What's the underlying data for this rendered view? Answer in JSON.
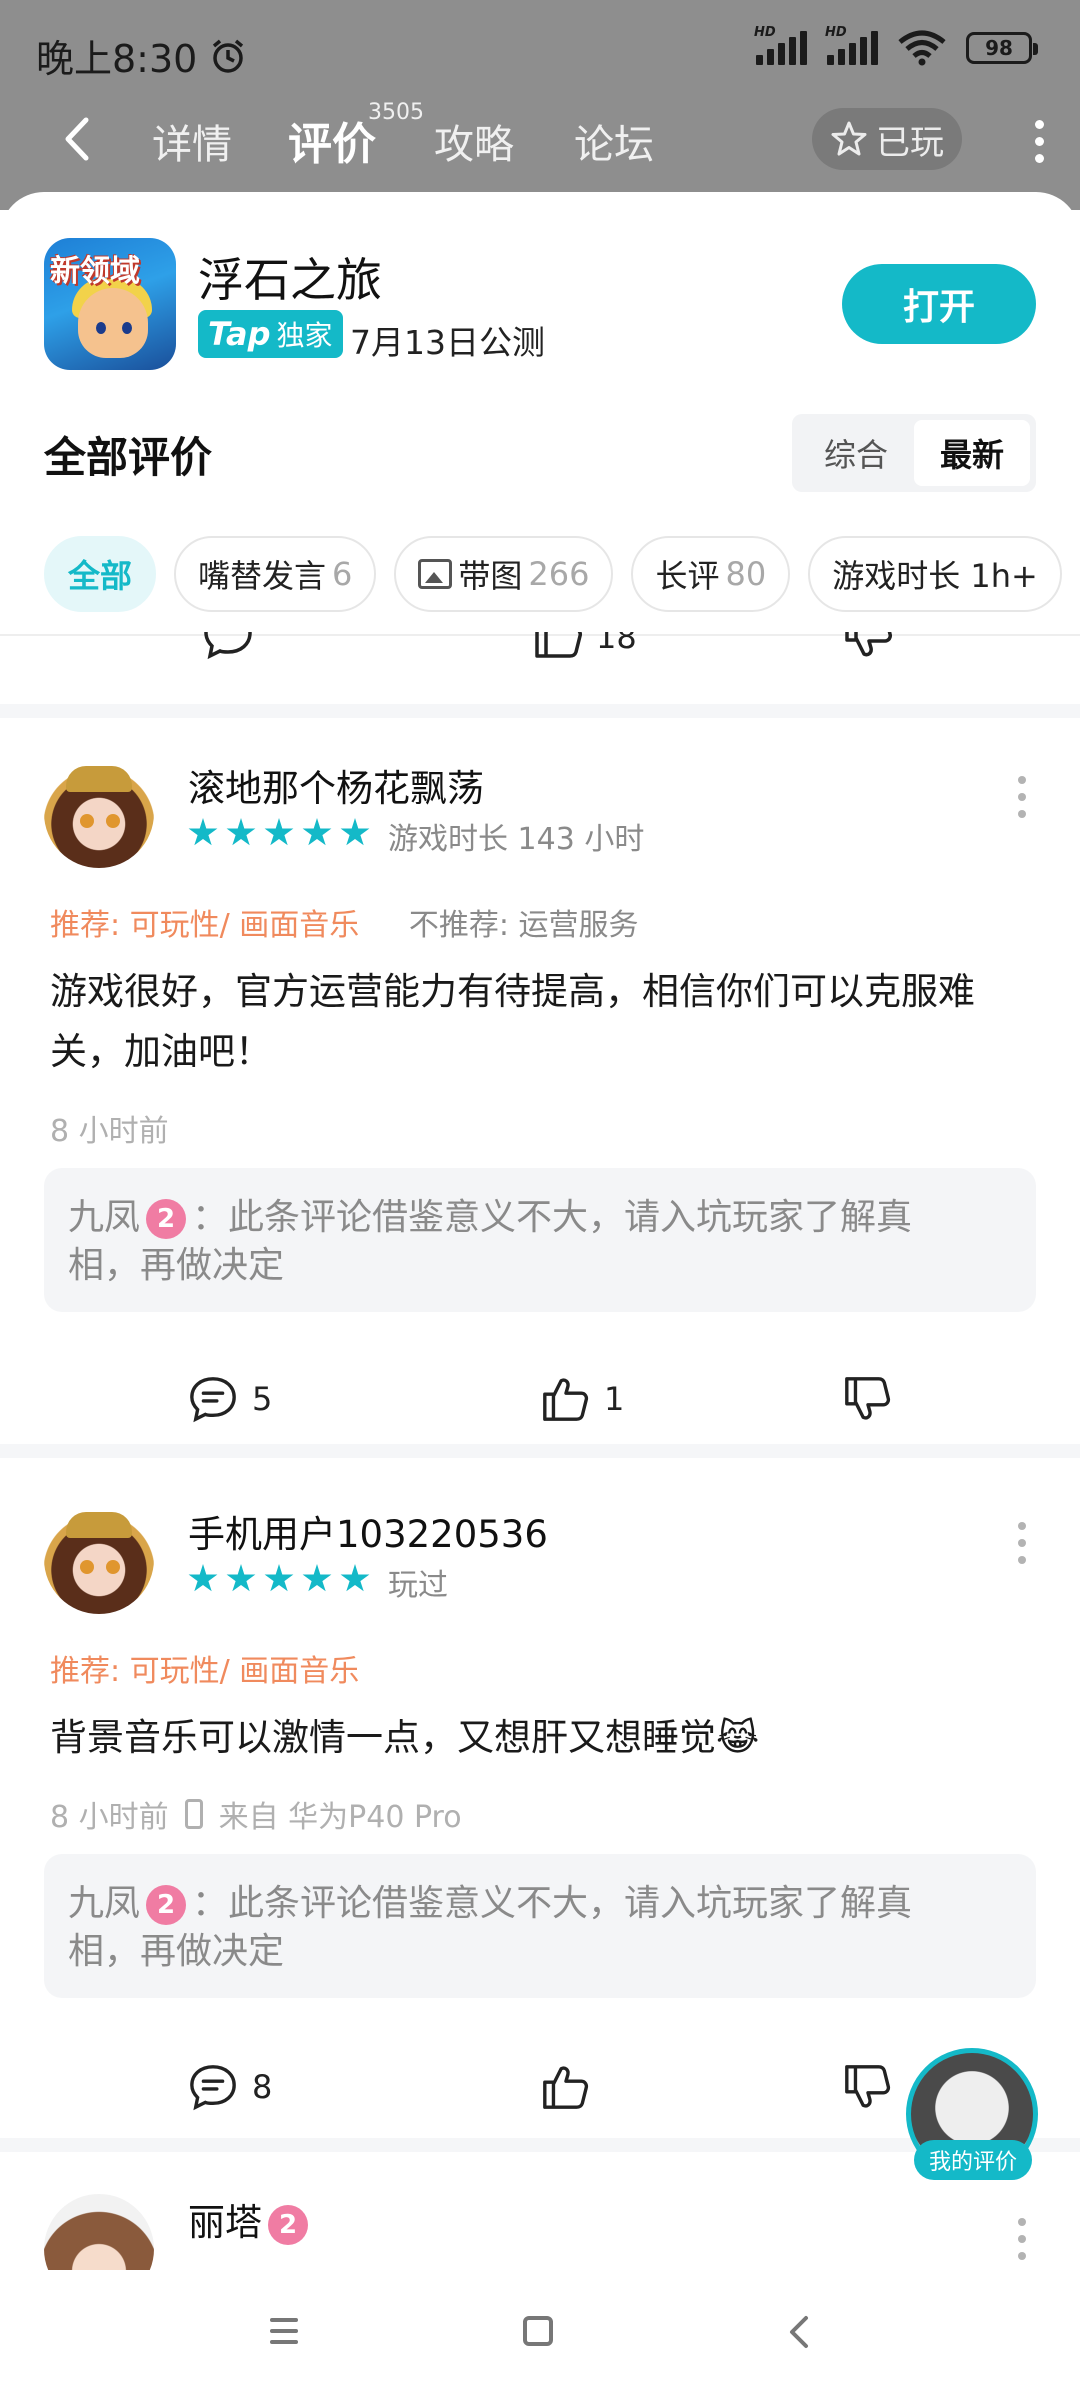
{
  "status": {
    "time": "晚上8:30",
    "battery": "98",
    "hd1": "HD",
    "hd2": "HD"
  },
  "nav": {
    "tabs": [
      {
        "label": "详情"
      },
      {
        "label": "评价"
      },
      {
        "label": "攻略"
      },
      {
        "label": "论坛"
      }
    ],
    "review_count_badge": "3505",
    "played_label": "已玩"
  },
  "game": {
    "icon_text": "新领域",
    "title": "浮石之旅",
    "tap_label": "Tap",
    "exclusive_label": "独家",
    "launch_date": "7月13日公测",
    "open_label": "打开"
  },
  "reviews_header": {
    "title": "全部评价",
    "sort_options": [
      "综合",
      "最新"
    ],
    "sort_selected": "最新"
  },
  "filters": [
    {
      "label": "全部",
      "count": ""
    },
    {
      "label": "嘴替发言",
      "count": "6"
    },
    {
      "label": "带图",
      "count": "266"
    },
    {
      "label": "长评",
      "count": "80"
    },
    {
      "label": "游戏时长 1h+",
      "count": ""
    }
  ],
  "partial_actions": {
    "likes": "18"
  },
  "reviews": [
    {
      "user": "滚地那个杨花飘荡",
      "rating": 5,
      "playtime": "游戏时长 143 小时",
      "recommend": "推荐: 可玩性/ 画面音乐",
      "not_recommend": "不推荐: 运营服务",
      "content_line1": "游戏很好，官方运营能力有待提高，相信你们可以克服难",
      "content_line2": "关，加油吧！",
      "time": "8 小时前",
      "device": "",
      "notice_user": "九凤",
      "notice_level": "2",
      "notice_text_line1": "：此条评论借鉴意义不大，请入坑玩家了解真",
      "notice_text_line2": "相，再做决定",
      "comments": "5",
      "likes": "1"
    },
    {
      "user": "手机用户103220536",
      "rating": 5,
      "playtime": "玩过",
      "recommend": "推荐: 可玩性/ 画面音乐",
      "not_recommend": "",
      "content_line1": "背景音乐可以激情一点，又想肝又想睡觉😹",
      "content_line2": "",
      "time": "8 小时前",
      "device": "来自 华为P40 Pro",
      "notice_user": "九凤",
      "notice_level": "2",
      "notice_text_line1": "：此条评论借鉴意义不大，请入坑玩家了解真",
      "notice_text_line2": "相，再做决定",
      "comments": "8",
      "likes": ""
    },
    {
      "user": "丽塔",
      "level": "2"
    }
  ],
  "floating": {
    "label": "我的评价"
  },
  "colors": {
    "accent": "#14b9c8",
    "recommend": "#f08a5d",
    "level_badge": "#f07ca3"
  }
}
